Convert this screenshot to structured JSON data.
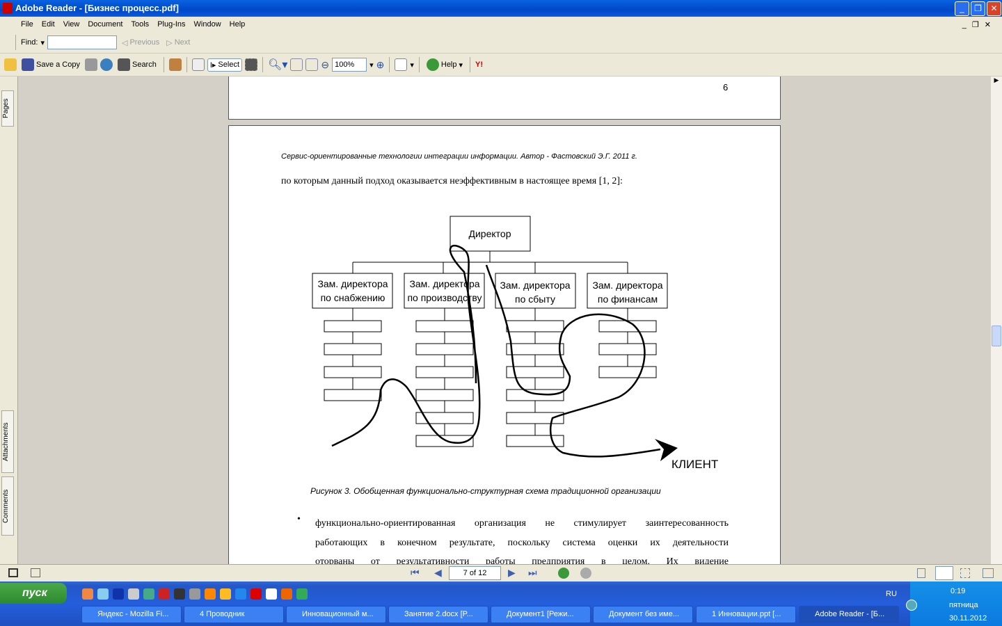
{
  "window": {
    "title": "Adobe Reader - [Бизнес процесс.pdf]"
  },
  "menu": [
    "File",
    "Edit",
    "View",
    "Document",
    "Tools",
    "Plug-Ins",
    "Window",
    "Help"
  ],
  "find": {
    "label": "Find:",
    "value": "",
    "previous": "Previous",
    "next": "Next"
  },
  "toolbar": {
    "save_copy": "Save a Copy",
    "search": "Search",
    "select": "Select",
    "zoom": "100%",
    "help": "Help"
  },
  "sidetabs": [
    "Pages",
    "Attachments",
    "Comments"
  ],
  "document": {
    "prev_page_number": "6",
    "header": "Сервис-ориентированные технологии интеграции информации. Автор - Фастовский Э.Г. 2011 г.",
    "intro": "по которым данный подход оказывается неэффективным в настоящее время [1, 2]:",
    "diagram": {
      "top": "Директор",
      "boxes": [
        [
          "Зам. директора",
          "по снабжению"
        ],
        [
          "Зам. директора",
          "по производству"
        ],
        [
          "Зам. директора",
          "по сбыту"
        ],
        [
          "Зам. директора",
          "по финансам"
        ]
      ],
      "client": "КЛИЕНТ"
    },
    "caption": "Рисунок 3. Обобщенная функционально-структурная схема традиционной организации",
    "bullet_lines": [
      "функционально-ориентированная организация не стимулирует заинтересованность",
      "работающих в конечном результате, поскольку система оценки их деятельности",
      "оторваны от результативности работы предприятия в целом. Их видение"
    ]
  },
  "status": {
    "page": "7 of 12"
  },
  "taskbar": {
    "start": "пуск",
    "lang": "RU",
    "time": "0:19",
    "day": "пятница",
    "date": "30.11.2012",
    "tasks": [
      "Яндекс - Mozilla Fi...",
      "4 Проводник",
      "Инновационный м...",
      "Занятие 2.docx [P...",
      "Документ1 [Режи...",
      "Документ без име...",
      "1 Инновации.ppt [...",
      "Adobe Reader - [Б..."
    ]
  }
}
